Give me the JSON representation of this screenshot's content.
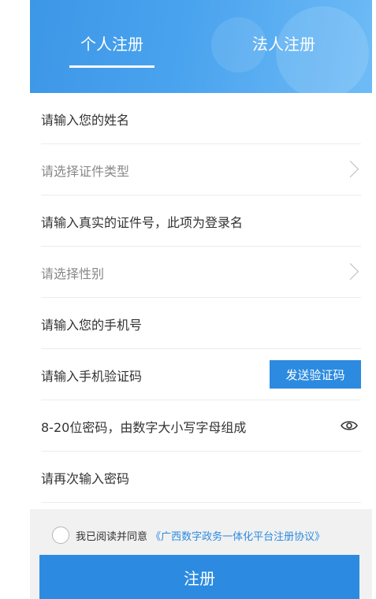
{
  "tabs": {
    "personal": "个人注册",
    "legal": "法人注册"
  },
  "form": {
    "name": "请输入您的姓名",
    "id_type": "请选择证件类型",
    "id_number": "请输入真实的证件号，此项为登录名",
    "gender": "请选择性别",
    "phone": "请输入您的手机号",
    "sms_code": "请输入手机验证码",
    "send_code": "发送验证码",
    "password": "8-20位密码，由数字大小写字母组成",
    "password_confirm": "请再次输入密码"
  },
  "agreement": {
    "prefix": "我已阅读并同意",
    "link": "《广西数字政务一体化平台注册协议》"
  },
  "submit_label": "注册",
  "icons": {
    "select_arrow": "chevron-right-icon",
    "password_toggle": "eye-icon",
    "agree_checkbox": "radio-circle-icon"
  },
  "colors": {
    "header_gradient_start": "#3d97e7",
    "header_gradient_end": "#6ebbf6",
    "primary": "#2c8be0",
    "text": "#333333",
    "placeholder": "#888888",
    "agree_bg": "#f1f1f1"
  }
}
